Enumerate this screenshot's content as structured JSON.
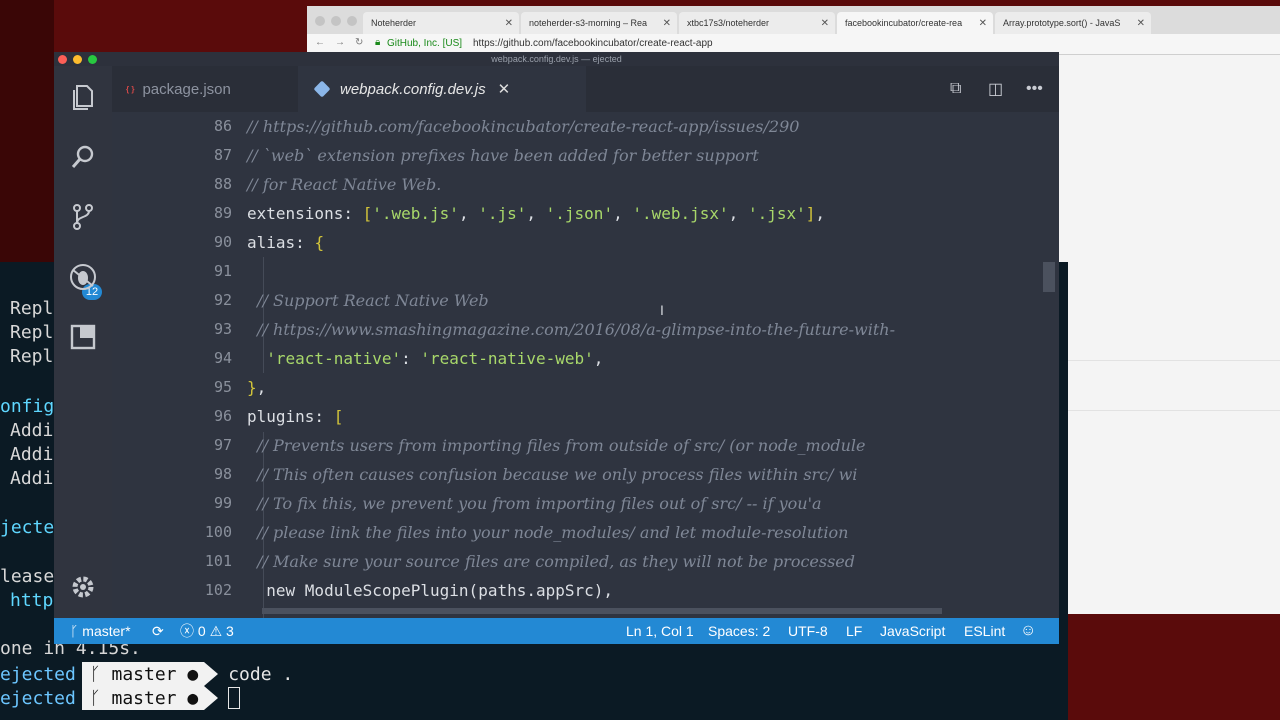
{
  "browser": {
    "tabs": [
      {
        "label": "Noteherder"
      },
      {
        "label": "noteherder-s3-morning – Rea"
      },
      {
        "label": "xtbc17s3/noteherder"
      },
      {
        "label": "facebookincubator/create-rea"
      },
      {
        "label": "Array.prototype.sort() - JavaS"
      }
    ],
    "secure_label": "GitHub, Inc. [US]",
    "url": "https://github.com/facebookincubator/create-react-app"
  },
  "terminal": {
    "left_lines": [
      "Repl",
      "Repl",
      "Repl",
      "onfig",
      "Addi",
      "Addi",
      "Addi",
      "jecte",
      "lease",
      "http"
    ],
    "done_line": "one in 4.15s.",
    "prompts": [
      {
        "dir": "ejected",
        "branch": "master",
        "cmd": "code ."
      },
      {
        "dir": "ejected",
        "branch": "master",
        "cmd": ""
      }
    ]
  },
  "vscode": {
    "window_title": "webpack.config.dev.js — ejected",
    "tabs": [
      {
        "label": "package.json",
        "icon": "json-file-icon",
        "active": false
      },
      {
        "label": "webpack.config.dev.js",
        "icon": "webpack-file-icon",
        "active": true
      }
    ],
    "activity_badge": "12",
    "lines": [
      {
        "n": "86",
        "text": "// https://github.com/facebookincubator/create-react-app/issues/290",
        "kind": "comment-url"
      },
      {
        "n": "87",
        "text": "// `web` extension prefixes have been added for better support",
        "kind": "comment"
      },
      {
        "n": "88",
        "text": "// for React Native Web.",
        "kind": "comment"
      },
      {
        "n": "89",
        "text": "extensions: ['.web.js', '.js', '.json', '.web.jsx', '.jsx'],",
        "kind": "code"
      },
      {
        "n": "90",
        "text": "alias: {",
        "kind": "code"
      },
      {
        "n": "91",
        "text": "",
        "kind": "code"
      },
      {
        "n": "92",
        "text": "  // Support React Native Web",
        "kind": "comment"
      },
      {
        "n": "93",
        "text": "  // https://www.smashingmagazine.com/2016/08/a-glimpse-into-the-future-with-",
        "kind": "comment-url"
      },
      {
        "n": "94",
        "text": "  'react-native': 'react-native-web',",
        "kind": "code"
      },
      {
        "n": "95",
        "text": "},",
        "kind": "code"
      },
      {
        "n": "96",
        "text": "plugins: [",
        "kind": "code"
      },
      {
        "n": "97",
        "text": "  // Prevents users from importing files from outside of src/ (or node_module",
        "kind": "comment"
      },
      {
        "n": "98",
        "text": "  // This often causes confusion because we only process files within src/ wi",
        "kind": "comment"
      },
      {
        "n": "99",
        "text": "  // To fix this, we prevent you from importing files out of src/ -- if you'a",
        "kind": "comment"
      },
      {
        "n": "100",
        "text": "  // please link the files into your node_modules/ and let module-resolution",
        "kind": "comment"
      },
      {
        "n": "101",
        "text": "  // Make sure your source files are compiled, as they will not be processed",
        "kind": "comment"
      },
      {
        "n": "102",
        "text": "  new ModuleScopePlugin(paths.appSrc),",
        "kind": "code"
      }
    ],
    "status": {
      "branch": "master*",
      "errors": "0",
      "warnings": "3",
      "position": "Ln 1, Col 1",
      "spaces": "Spaces: 2",
      "encoding": "UTF-8",
      "eol": "LF",
      "language": "JavaScript",
      "linter": "ESLint"
    }
  },
  "colors": {
    "statusbar": "#2389d4",
    "editor_bg": "#2f3440",
    "string": "#a8d86a",
    "bracket": "#d2c43a"
  }
}
